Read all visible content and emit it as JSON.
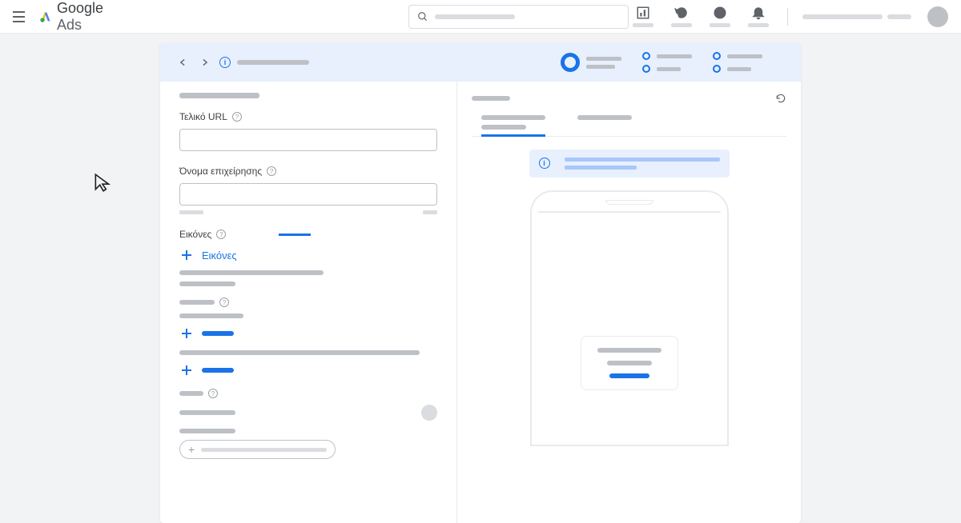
{
  "brand": {
    "name1": "Google",
    "name2": "Ads"
  },
  "header": {
    "search_placeholder": ""
  },
  "form": {
    "final_url_label": "Τελικό URL",
    "business_name_label": "Όνομα επιχείρησης",
    "images_label": "Εικόνες",
    "add_images_label": "Εικόνες"
  },
  "colors": {
    "accent": "#1a73e8"
  }
}
